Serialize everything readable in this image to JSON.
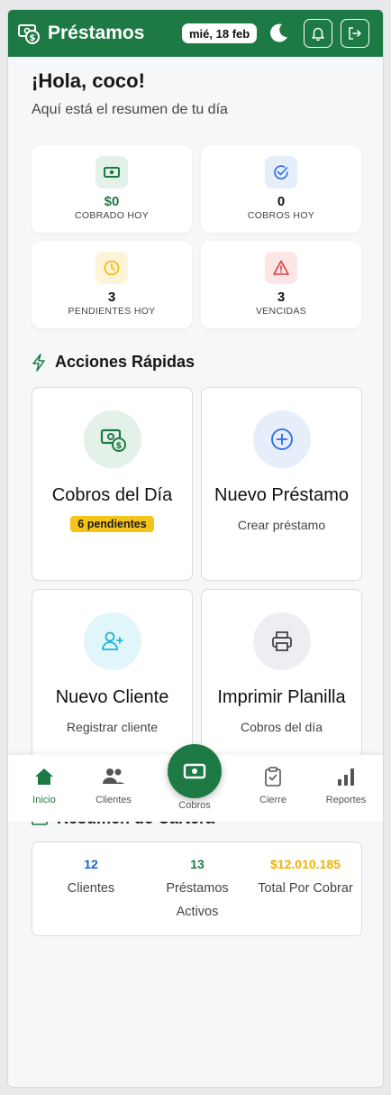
{
  "header": {
    "title": "Préstamos",
    "date": "mié, 18 feb"
  },
  "greeting": {
    "title": "¡Hola, coco!",
    "subtitle": "Aquí está el resumen de tu día"
  },
  "stats": [
    {
      "value": "$0",
      "label": "COBRADO HOY",
      "icon": "cash-icon",
      "color": "#1d7a45"
    },
    {
      "value": "0",
      "label": "COBROS HOY",
      "icon": "check-circle-icon",
      "color": "#111111"
    },
    {
      "value": "3",
      "label": "PENDIENTES HOY",
      "icon": "clock-icon",
      "color": "#111111"
    },
    {
      "value": "3",
      "label": "VENCIDAS",
      "icon": "warning-icon",
      "color": "#111111"
    }
  ],
  "quick_actions": {
    "title": "Acciones Rápidas",
    "items": [
      {
        "title": "Cobros del Día",
        "badge": "6 pendientes",
        "icon": "money-icon"
      },
      {
        "title": "Nuevo Préstamo",
        "desc": "Crear préstamo",
        "icon": "plus-circle-icon"
      },
      {
        "title": "Nuevo Cliente",
        "desc": "Registrar cliente",
        "icon": "add-user-icon"
      },
      {
        "title": "Imprimir Planilla",
        "desc": "Cobros del día",
        "icon": "printer-icon"
      }
    ]
  },
  "portfolio": {
    "title": "Resumen de Cartera",
    "items": [
      {
        "value": "12",
        "label": "Clientes",
        "color": "#1565d8"
      },
      {
        "value": "13",
        "label": "Préstamos Activos",
        "color": "#1d7a45"
      },
      {
        "value": "$12.010.185",
        "label": "Total Por Cobrar",
        "color": "#f0b400"
      }
    ]
  },
  "nav": {
    "items": [
      {
        "label": "Inicio",
        "icon": "home-icon",
        "active": true
      },
      {
        "label": "Clientes",
        "icon": "users-icon"
      },
      {
        "label": "Cobros",
        "icon": "cash-icon"
      },
      {
        "label": "Cierre",
        "icon": "clipboard-check-icon"
      },
      {
        "label": "Reportes",
        "icon": "bar-chart-icon"
      }
    ]
  },
  "colors": {
    "brand": "#1d7a45",
    "badge": "#f5c41a"
  }
}
